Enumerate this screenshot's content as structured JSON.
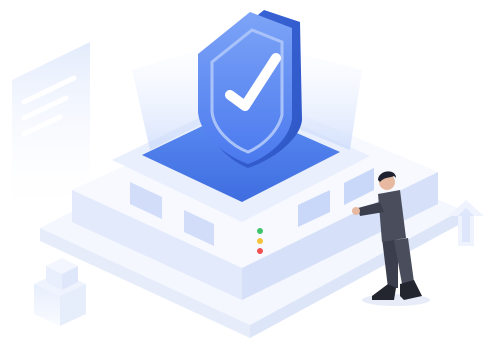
{
  "illustration": {
    "icons": {
      "shield": "shield-check-icon",
      "document": "document-icon",
      "upload": "arrow-up-icon",
      "cubes": "stacked-cubes-icon",
      "person": "businessman-figure"
    },
    "colors": {
      "shield_front": "#5b8cf3",
      "shield_side": "#3f6de0",
      "accent_blue": "#4a79ee",
      "platform_light": "#f2f5fd",
      "platform_edge": "#dfe6f8",
      "panel_light": "#dbe4fb",
      "led_green": "#3fc46a",
      "led_yellow": "#f2c33a",
      "led_red": "#ef5050",
      "suit": "#4a4e5c",
      "hair": "#1f2130"
    }
  }
}
